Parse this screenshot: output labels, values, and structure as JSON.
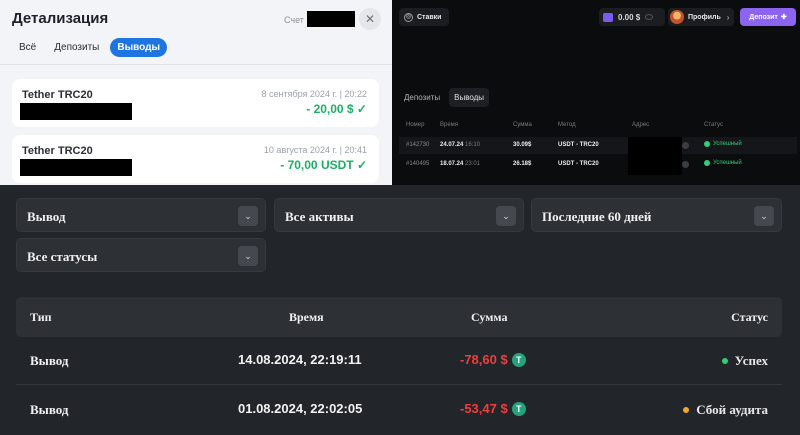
{
  "detail": {
    "title": "Детализация",
    "account_label": "Счет",
    "close_glyph": "✕",
    "tabs": [
      {
        "label": "Всё",
        "active": false
      },
      {
        "label": "Депозиты",
        "active": false
      },
      {
        "label": "Выводы",
        "active": true
      }
    ],
    "items": [
      {
        "name": "Tether TRC20",
        "date": "8 сентября 2024 г. | 20:22",
        "amount": "- 20,00 $ ✓"
      },
      {
        "name": "Tether TRC20",
        "date": "10 августа 2024 г. | 20:41",
        "amount": "- 70,00 USDT ✓"
      }
    ],
    "colors": {
      "accent": "#1e74e0",
      "positive": "#19b062"
    }
  },
  "casino": {
    "bets_label": "Ставки",
    "bets_icon": "globe-icon",
    "balance": "0.00 $",
    "profile_label": "Профиль",
    "deposit_label": "Депозит",
    "deposit_icon": "plus-icon",
    "subtabs": [
      {
        "label": "Депозиты",
        "active": false
      },
      {
        "label": "Выводы",
        "active": true
      }
    ],
    "headers": {
      "number": "Номер",
      "time": "Время",
      "sum": "Сумма",
      "method": "Метод",
      "address": "Адрес",
      "status": "Статус"
    },
    "rows": [
      {
        "number": "#142730",
        "date": "24.07.24",
        "time": "16:10",
        "sum": "30.09$",
        "method": "USDT - TRC20",
        "status": "Успешный"
      },
      {
        "number": "#140495",
        "date": "18.07.24",
        "time": "23:01",
        "sum": "26.18$",
        "method": "USDT - TRC20",
        "status": "Успешный"
      }
    ],
    "colors": {
      "accent": "#8d63f2",
      "success": "#2fcf7a"
    }
  },
  "history": {
    "filters": {
      "type": "Вывод",
      "assets": "Все активы",
      "period": "Последние 60 дней",
      "status": "Все статусы"
    },
    "columns": {
      "type": "Тип",
      "time": "Время",
      "sum": "Сумма",
      "status": "Статус"
    },
    "rows": [
      {
        "type": "Вывод",
        "time": "14.08.2024, 22:19:11",
        "sum": "-78,60 $",
        "token": "T",
        "status": "Успех",
        "status_color": "#2fcf7a"
      },
      {
        "type": "Вывод",
        "time": "01.08.2024, 22:02:05",
        "sum": "-53,47 $",
        "token": "T",
        "status": "Сбой аудита",
        "status_color": "#f5a623"
      }
    ],
    "colors": {
      "negative": "#ef3e3e",
      "token": "#26a17b"
    }
  }
}
